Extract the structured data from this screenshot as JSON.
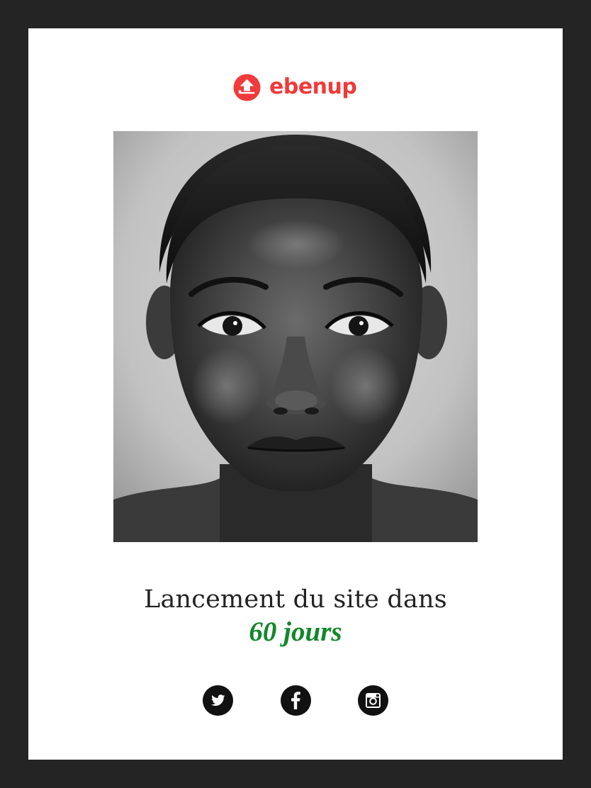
{
  "brand": {
    "name": "ebenup",
    "color": "#ef3b3b"
  },
  "hero": {
    "icon": "portrait-photo",
    "style": "black-and-white"
  },
  "announcement": {
    "line1": "Lancement du site dans",
    "countdown": "60 jours",
    "countdown_color": "#13872a"
  },
  "social": [
    {
      "icon": "twitter-icon"
    },
    {
      "icon": "facebook-icon"
    },
    {
      "icon": "instagram-icon"
    }
  ],
  "colors": {
    "background": "#242424",
    "card": "#ffffff",
    "text": "#222222",
    "social_circle": "#111111"
  }
}
